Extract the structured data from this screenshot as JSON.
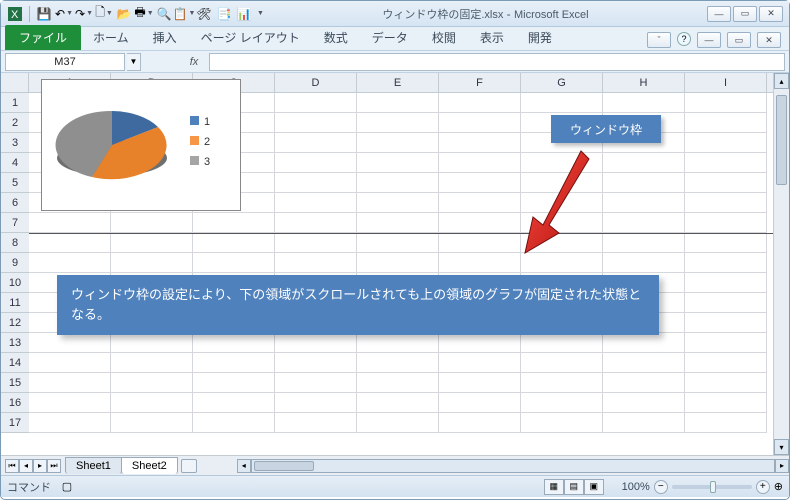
{
  "title_file": "ウィンドウ枠の固定.xlsx",
  "title_app": "Microsoft Excel",
  "file_tab": "ファイル",
  "ribbon_tabs": [
    "ホーム",
    "挿入",
    "ページ レイアウト",
    "数式",
    "データ",
    "校閲",
    "表示",
    "開発"
  ],
  "namebox": "M37",
  "fx_label": "fx",
  "columns": [
    "A",
    "B",
    "C",
    "D",
    "E",
    "F",
    "G",
    "H",
    "I"
  ],
  "rows": [
    "1",
    "2",
    "3",
    "4",
    "5",
    "6",
    "7",
    "8",
    "9",
    "10",
    "11",
    "12",
    "13",
    "14",
    "15",
    "16",
    "17"
  ],
  "chart_data": {
    "type": "pie",
    "title": "",
    "legend_position": "right",
    "series": [
      {
        "name": "1",
        "value": 15,
        "color": "#4f81bd"
      },
      {
        "name": "2",
        "value": 45,
        "color": "#c0504d"
      },
      {
        "name": "3",
        "value": 40,
        "color": "#9bbb59"
      }
    ],
    "legend_colors": [
      "#4f81bd",
      "#f79646",
      "#a5a5a5"
    ],
    "slice_colors": [
      "#3e6aa0",
      "#e8822a",
      "#8f8f8f"
    ]
  },
  "annotation_tag": "ウィンドウ枠",
  "annotation_box": "ウィンドウ枠の設定により、下の領域がスクロールされても上の領域のグラフが固定された状態となる。",
  "sheet_tabs": [
    "Sheet1",
    "Sheet2"
  ],
  "active_sheet": 1,
  "status_text": "コマンド",
  "zoom": "100%",
  "zoom_expand": "⊕"
}
